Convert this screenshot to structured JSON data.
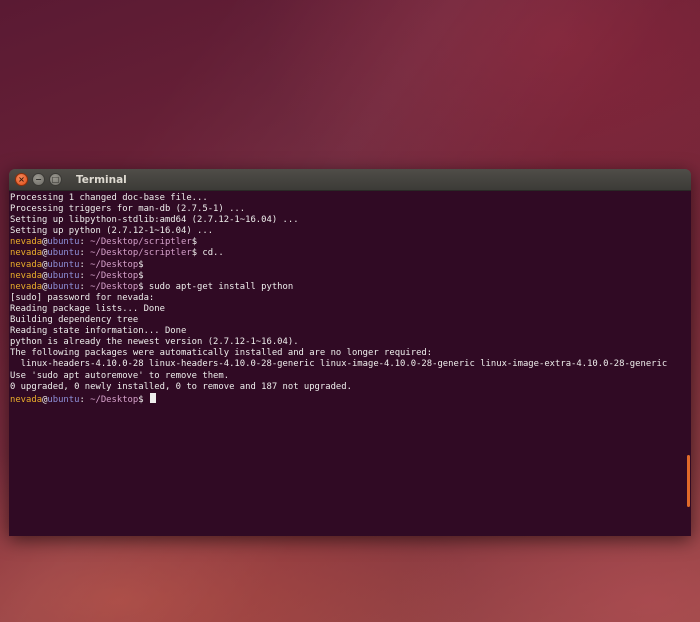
{
  "window": {
    "title": "Terminal",
    "buttons": {
      "close": "×",
      "minimize": "−",
      "maximize": "□"
    }
  },
  "terminal": {
    "output_lines": [
      "Processing 1 changed doc-base file...",
      "Processing triggers for man-db (2.7.5-1) ...",
      "Setting up libpython-stdlib:amd64 (2.7.12-1~16.04) ...",
      "Setting up python (2.7.12-1~16.04) ..."
    ],
    "prompts": [
      {
        "user": "nevada",
        "host": "ubuntu",
        "path": "~/Desktop/scriptler",
        "command": ""
      },
      {
        "user": "nevada",
        "host": "ubuntu",
        "path": "~/Desktop/scriptler",
        "command": " cd.."
      },
      {
        "user": "nevada",
        "host": "ubuntu",
        "path": "~/Desktop",
        "command": ""
      },
      {
        "user": "nevada",
        "host": "ubuntu",
        "path": "~/Desktop",
        "command": ""
      },
      {
        "user": "nevada",
        "host": "ubuntu",
        "path": "~/Desktop",
        "command": " sudo apt-get install python"
      }
    ],
    "install_output": [
      "[sudo] password for nevada:",
      "Reading package lists... Done",
      "Building dependency tree",
      "Reading state information... Done",
      "python is already the newest version (2.7.12-1~16.04).",
      "The following packages were automatically installed and are no longer required:",
      "  linux-headers-4.10.0-28 linux-headers-4.10.0-28-generic linux-image-4.10.0-28-generic linux-image-extra-4.10.0-28-generic",
      "Use 'sudo apt autoremove' to remove them.",
      "0 upgraded, 0 newly installed, 0 to remove and 187 not upgraded."
    ],
    "final_prompt": {
      "user": "nevada",
      "host": "ubuntu",
      "path": "~/Desktop",
      "command": " "
    },
    "prompt_symbols": {
      "at": "@",
      "colon": ": ",
      "dollar": "$"
    },
    "scroll_position": 0.9
  },
  "colors": {
    "terminal_bg": "#300a24",
    "prompt_user": "#e9ad2b",
    "prompt_host": "#8e8fd8",
    "prompt_path": "#d4a0c9",
    "scroll_thumb": "#e06a2a",
    "close_button": "#df4b16"
  }
}
